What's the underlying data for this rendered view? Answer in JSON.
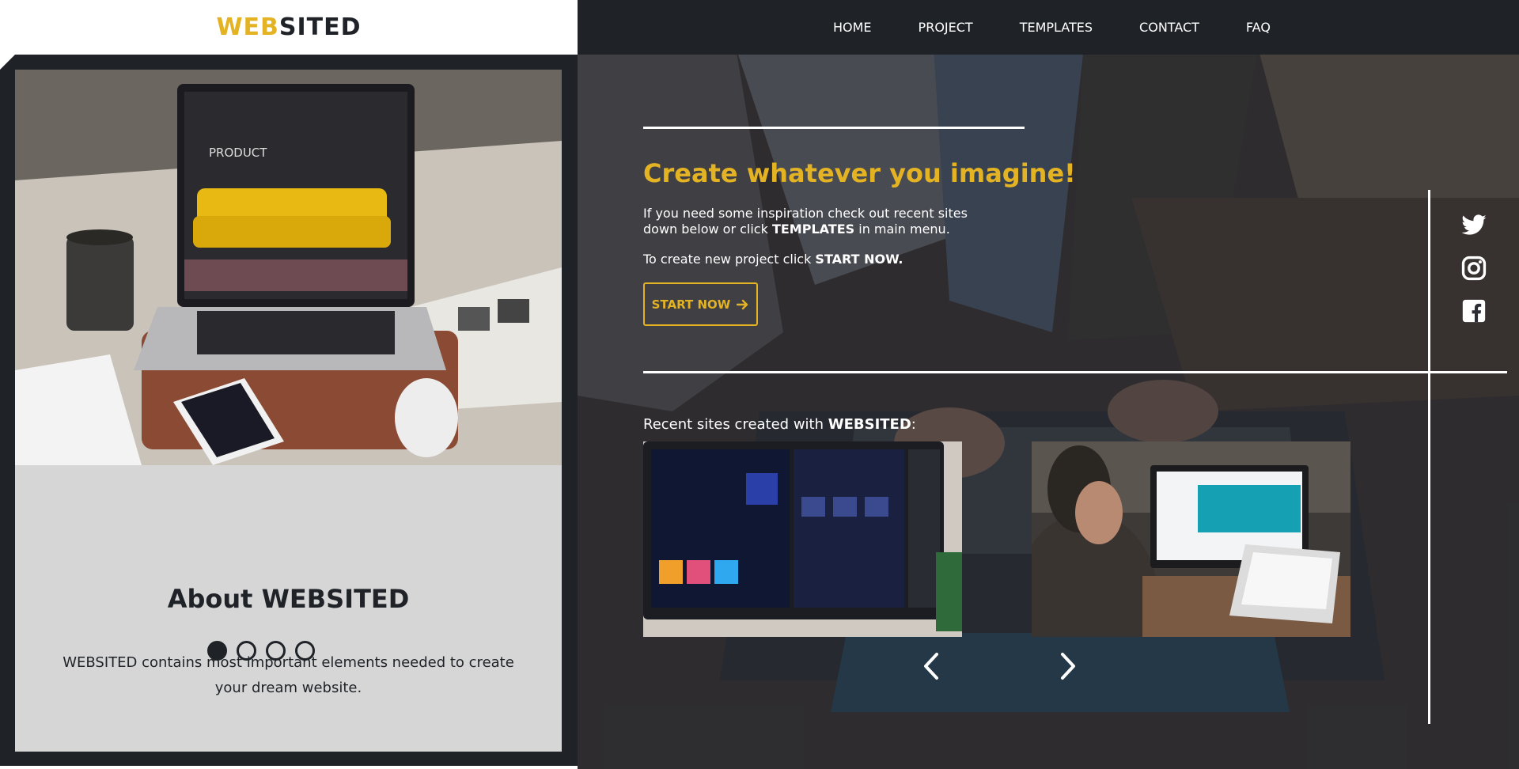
{
  "logo": {
    "part1": "WEB",
    "part2": "SITED"
  },
  "nav": {
    "items": [
      {
        "label": "HOME"
      },
      {
        "label": "PROJECT"
      },
      {
        "label": "TEMPLATES"
      },
      {
        "label": "CONTACT"
      },
      {
        "label": "FAQ"
      }
    ]
  },
  "hero": {
    "headline": "Create whatever you imagine!",
    "intro_prefix": "If you need some inspiration check out recent sites down below or click ",
    "intro_bold": "TEMPLATES",
    "intro_suffix": " in main menu.",
    "intro2_prefix": "To create new project click ",
    "intro2_bold": "START NOW.",
    "start_button_label": "START NOW",
    "start_button_icon": "arrow-right-icon",
    "recent_prefix": "Recent sites created with ",
    "recent_bold": "WEBSITED",
    "recent_suffix": ":"
  },
  "about": {
    "title": "About WEBSITED",
    "text": "WEBSITED contains most important elements needed to create your dream website.",
    "slides_total": 4,
    "slide_active": 1
  },
  "laptop_screen": {
    "title": "PRODUCT"
  },
  "social": {
    "icons": [
      "twitter-icon",
      "instagram-icon",
      "facebook-icon"
    ]
  },
  "colors": {
    "dark": "#1f2328",
    "accent": "#e3b324",
    "card_bg": "#d6d6d6",
    "white": "#ffffff"
  }
}
